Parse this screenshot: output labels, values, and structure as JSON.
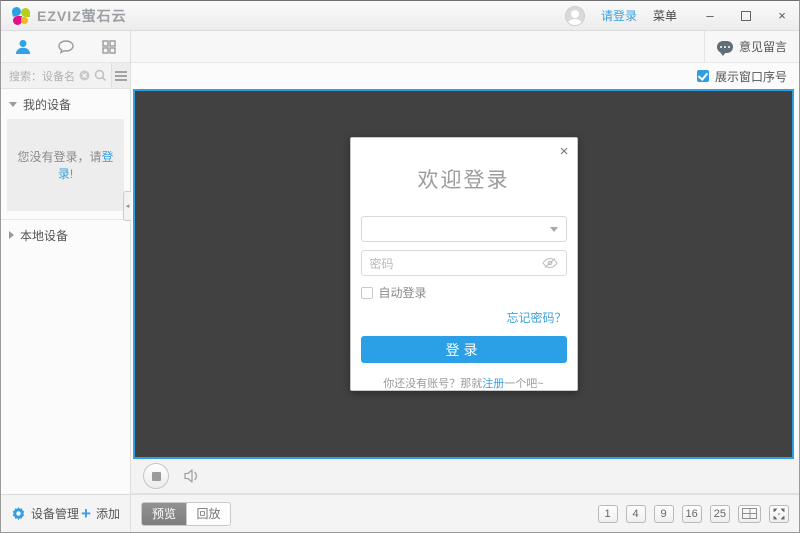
{
  "colors": {
    "accent": "#2f9fe0",
    "video_background": "#414141",
    "video_border": "#2f9fe0",
    "login_button": "#2ba0e6",
    "preview_tab_active": "#7e7e7e"
  },
  "titlebar": {
    "app_name": "EZVIZ萤石云",
    "login_link": "请登录",
    "menu_label": "菜单",
    "minimize": "–",
    "close": "×"
  },
  "main_toolbar": {
    "feedback_label": "意见留言"
  },
  "options": {
    "show_window_number_label": "展示窗口序号"
  },
  "sidebar": {
    "search_placeholder": "搜索：设备名",
    "my_devices_label": "我的设备",
    "not_logged_prefix": "您没有登录，请",
    "not_logged_login_link": "登录",
    "not_logged_suffix": "!",
    "local_devices_label": "本地设备",
    "device_manage_label": "设备管理",
    "add_label": "添加",
    "collapse_arrow": "◂"
  },
  "dialog": {
    "close": "×",
    "title": "欢迎登录",
    "account_value": "",
    "password_placeholder": "密码",
    "auto_login_label": "自动登录",
    "forgot_password_link": "忘记密码？",
    "login_button_label": "登录",
    "register_prefix": "你还没有账号？那就",
    "register_link": "注册",
    "register_suffix": "一个吧~"
  },
  "bottom_bar": {
    "preview_tab": "预览",
    "playback_tab": "回放",
    "grid_buttons": [
      "1",
      "4",
      "9",
      "16",
      "25"
    ]
  }
}
